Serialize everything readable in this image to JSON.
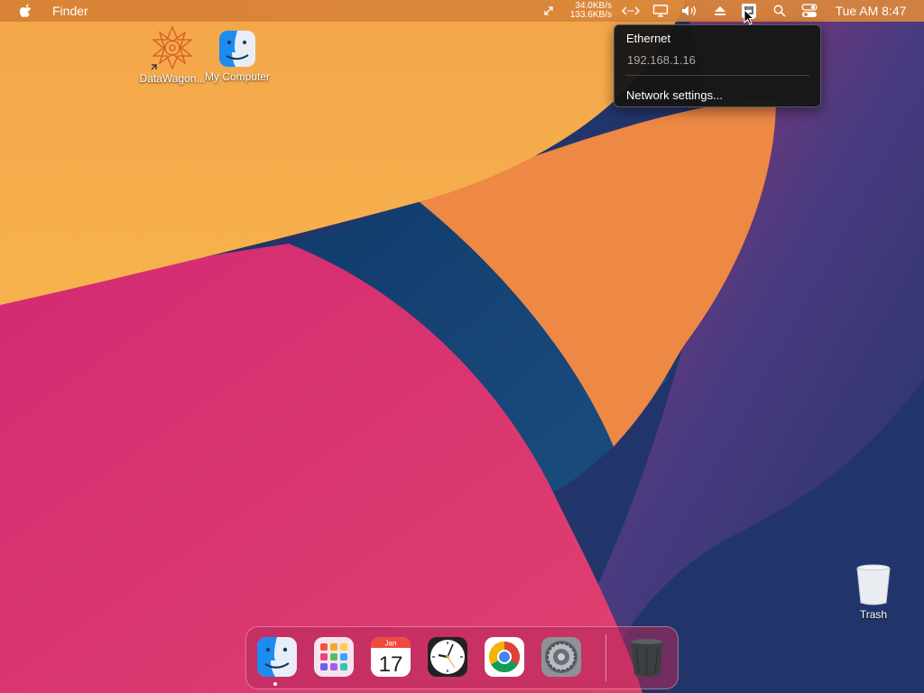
{
  "menubar": {
    "app_name": "Finder",
    "net_upload": "34.0KB/s",
    "net_download": "133.6KB/s",
    "clock": "Tue AM 8:47",
    "icons": [
      "apple-icon",
      "share-arrows-icon",
      "network-arrows-icon",
      "display-icon",
      "volume-icon",
      "eject-icon",
      "ethernet-icon",
      "search-icon",
      "control-center-icon"
    ]
  },
  "network_menu": {
    "title": "Ethernet",
    "ip": "192.168.1.16",
    "settings_label": "Network settings..."
  },
  "desktop": {
    "icons": [
      {
        "label": "DataWagon...",
        "icon": "datawagon-icon"
      },
      {
        "label": "My Computer",
        "icon": "finder-icon"
      },
      {
        "label": "Trash",
        "icon": "trash-icon"
      }
    ]
  },
  "dock": {
    "items": [
      "finder-icon",
      "launchpad-icon",
      "calendar-icon",
      "clock-icon",
      "chrome-icon",
      "settings-icon",
      "trash-icon"
    ],
    "calendar_month": "Jan",
    "calendar_day": "17"
  },
  "colors": {
    "wallpaper_yellow": "#f5a84a",
    "wallpaper_orange": "#ee8a45",
    "wallpaper_pink": "#d62e70",
    "wallpaper_navy": "#1f3565",
    "wallpaper_purple": "#6a3780",
    "menu_bg": "#161616"
  }
}
